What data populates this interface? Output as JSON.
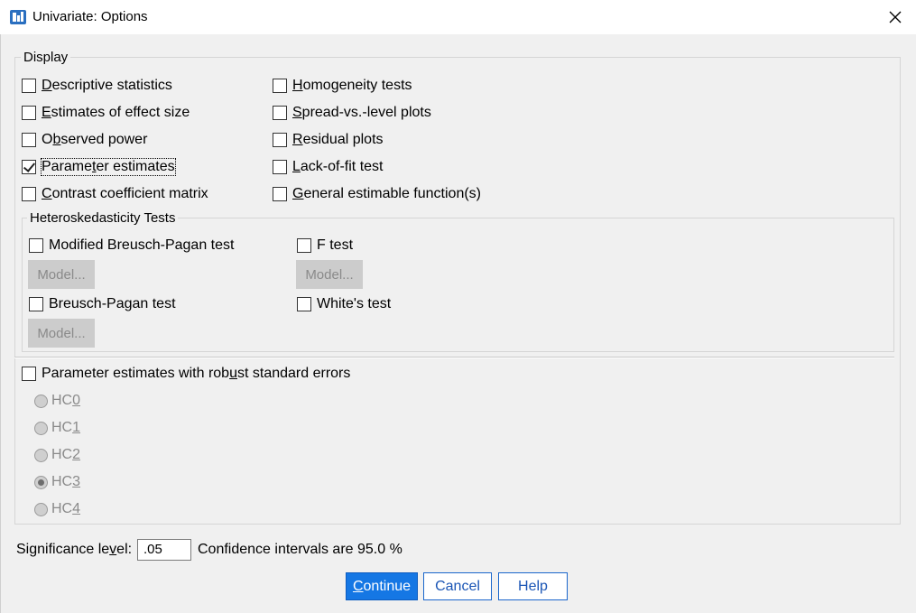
{
  "window": {
    "title": "Univariate: Options"
  },
  "display": {
    "legend": "Display",
    "left": [
      {
        "pre": "",
        "u": "D",
        "post": "escriptive statistics",
        "checked": false
      },
      {
        "pre": "",
        "u": "E",
        "post": "stimates of effect size",
        "checked": false
      },
      {
        "pre": "O",
        "u": "b",
        "post": "served power",
        "checked": false
      },
      {
        "pre": "Parame",
        "u": "t",
        "post": "er estimates",
        "checked": true
      },
      {
        "pre": "",
        "u": "C",
        "post": "ontrast coefficient matrix",
        "checked": false
      }
    ],
    "right": [
      {
        "pre": "",
        "u": "H",
        "post": "omogeneity tests",
        "checked": false
      },
      {
        "pre": "",
        "u": "S",
        "post": "pread-vs.-level plots",
        "checked": false
      },
      {
        "pre": "",
        "u": "R",
        "post": "esidual plots",
        "checked": false
      },
      {
        "pre": "",
        "u": "L",
        "post": "ack-of-fit test",
        "checked": false
      },
      {
        "pre": "",
        "u": "G",
        "post": "eneral estimable function(s)",
        "checked": false
      }
    ]
  },
  "hetero": {
    "legend": "Heteroskedasticity Tests",
    "modified_bp": "Modified Breusch-Pagan test",
    "f_test": "F test",
    "bp": "Breusch-Pagan test",
    "white": "White's test",
    "model_label": "Model..."
  },
  "robust": {
    "pre": "Parameter estimates with rob",
    "u": "u",
    "post": "st standard errors",
    "checked": false,
    "options": [
      {
        "pre": "HC",
        "u": "0",
        "selected": false
      },
      {
        "pre": "HC",
        "u": "1",
        "selected": false
      },
      {
        "pre": "HC",
        "u": "2",
        "selected": false
      },
      {
        "pre": "HC",
        "u": "3",
        "selected": true
      },
      {
        "pre": "HC",
        "u": "4",
        "selected": false
      }
    ]
  },
  "significance": {
    "pre": "Significance le",
    "u": "v",
    "post": "el:",
    "value": ".05"
  },
  "confidence_text": "Confidence intervals are 95.0 %",
  "buttons": {
    "continue": {
      "pre": "",
      "u": "C",
      "post": "ontinue"
    },
    "cancel": "Cancel",
    "help": "Help"
  }
}
